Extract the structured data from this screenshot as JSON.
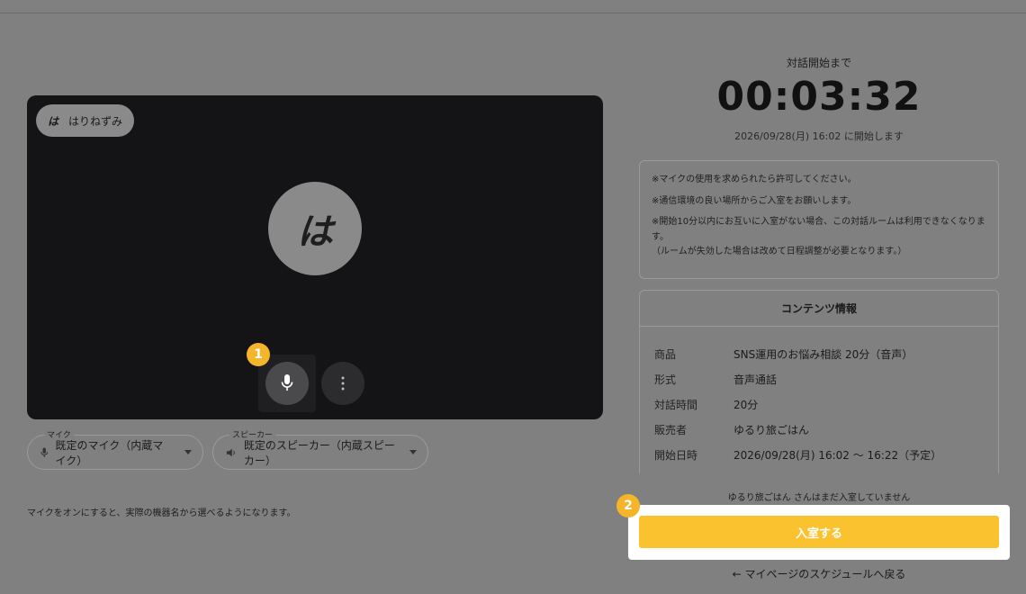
{
  "video": {
    "initial": "は",
    "participant_name": "はりねずみ",
    "avatar_initial": "は",
    "mic_badge": "1"
  },
  "devices": {
    "mic_label": "マイク",
    "mic_value": "既定のマイク（内蔵マイク）",
    "speaker_label": "スピーカー",
    "speaker_value": "既定のスピーカー（内蔵スピーカー）",
    "note": "マイクをオンにすると、実際の機器名から選べるようになります。"
  },
  "countdown": {
    "label": "対話開始まで",
    "time": "00:03:32",
    "start_text": "2026/09/28(月) 16:02 に開始します"
  },
  "notice": {
    "line1": "※マイクの使用を求められたら許可してください。",
    "line2": "※通信環境の良い場所からご入室をお願いします。",
    "line3": "※開始10分以内にお互いに入室がない場合、この対話ルームは利用できなくなります。",
    "line4": "（ルームが失効した場合は改めて日程調整が必要となります。）"
  },
  "content_info": {
    "title": "コンテンツ情報",
    "rows": [
      {
        "key": "商品",
        "value": "SNS運用のお悩み相談 20分（音声）"
      },
      {
        "key": "形式",
        "value": "音声通話"
      },
      {
        "key": "対話時間",
        "value": "20分"
      },
      {
        "key": "販売者",
        "value": "ゆるり旅ごはん"
      },
      {
        "key": "開始日時",
        "value": "2026/09/28(月) 16:02 〜 16:22（予定）"
      }
    ]
  },
  "status": {
    "waiting_text": "ゆるり旅ごはん さんはまだ入室していません"
  },
  "actions": {
    "enter_badge": "2",
    "enter_label": "入室する",
    "back_label": "← マイページのスケジュールへ戻る"
  },
  "colors": {
    "accent": "#fbc22f",
    "badge": "#f5b52a",
    "video_bg": "#141417",
    "overlay_bg": "#808080"
  }
}
